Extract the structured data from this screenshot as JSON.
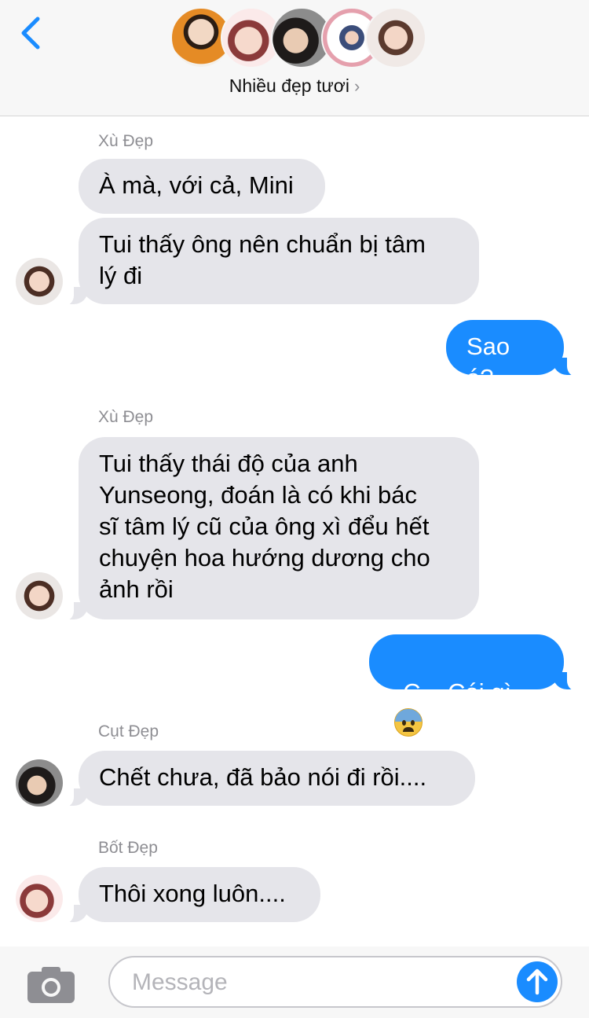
{
  "header": {
    "group_name": "Nhiều đẹp tươi",
    "chevron": "›",
    "back_icon": "chevron-left-icon",
    "accent": "#1a8cff"
  },
  "messages": [
    {
      "sender": "Xù Đẹp"
    },
    {
      "text": "À mà, với cả, Mini"
    },
    {
      "text": "Tui thấy ông nên chuẩn bị tâm\nlý đi"
    },
    {
      "text": "Sao á?"
    },
    {
      "sender": "Xù Đẹp"
    },
    {
      "text": "Tui thấy thái độ của anh\nYunseong, đoán là có khi bác\nsĩ tâm lý cũ của ông xì đểu hết\nchuyện hoa hướng dương cho\nảnh rồi"
    },
    {
      "text": "C....Cái gì",
      "emoji": "anxious-face-with-sweat"
    },
    {
      "sender": "Cụt Đẹp"
    },
    {
      "text": "Chết chưa, đã bảo nói đi rồi...."
    },
    {
      "sender": "Bốt Đẹp"
    },
    {
      "text": "Thôi xong luôn...."
    }
  ],
  "composer": {
    "placeholder": "Message",
    "camera_icon": "camera-icon",
    "send_icon": "arrow-up-icon"
  },
  "colors": {
    "incoming_bubble": "#e5e5ea",
    "outgoing_bubble": "#1a8cff",
    "sender_label": "#8e8e93"
  }
}
